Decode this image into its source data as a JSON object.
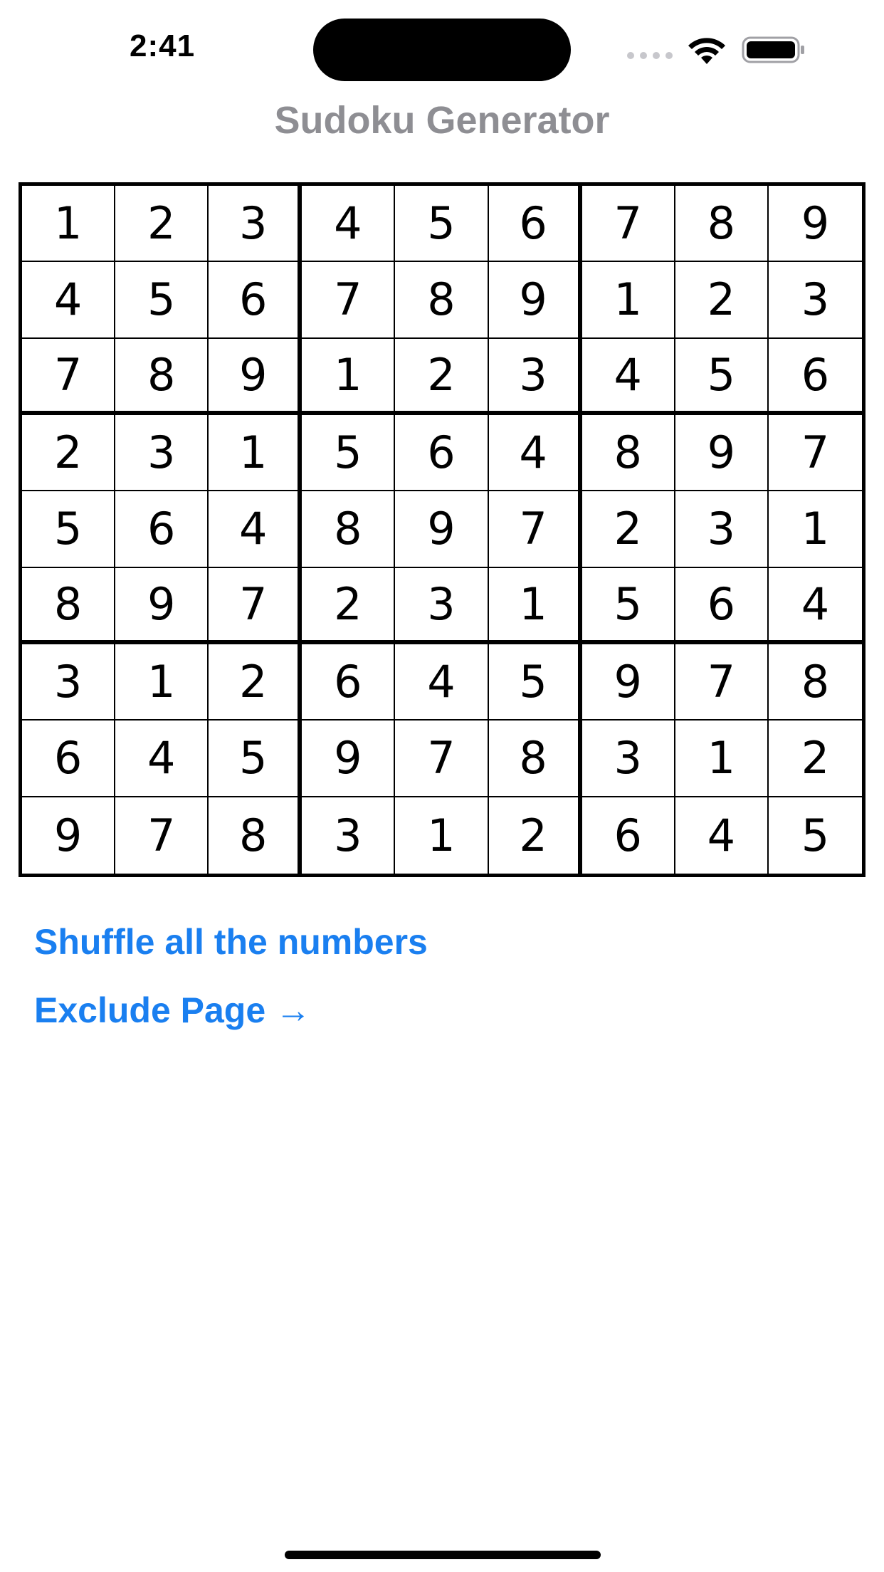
{
  "status_bar": {
    "time": "2:41"
  },
  "title": "Sudoku Generator",
  "grid": [
    [
      1,
      2,
      3,
      4,
      5,
      6,
      7,
      8,
      9
    ],
    [
      4,
      5,
      6,
      7,
      8,
      9,
      1,
      2,
      3
    ],
    [
      7,
      8,
      9,
      1,
      2,
      3,
      4,
      5,
      6
    ],
    [
      2,
      3,
      1,
      5,
      6,
      4,
      8,
      9,
      7
    ],
    [
      5,
      6,
      4,
      8,
      9,
      7,
      2,
      3,
      1
    ],
    [
      8,
      9,
      7,
      2,
      3,
      1,
      5,
      6,
      4
    ],
    [
      3,
      1,
      2,
      6,
      4,
      5,
      9,
      7,
      8
    ],
    [
      6,
      4,
      5,
      9,
      7,
      8,
      3,
      1,
      2
    ],
    [
      9,
      7,
      8,
      3,
      1,
      2,
      6,
      4,
      5
    ]
  ],
  "actions": {
    "shuffle_label": "Shuffle all the numbers",
    "exclude_label": "Exclude Page →"
  },
  "colors": {
    "accent": "#1a7ff0",
    "title": "#8e8e93"
  },
  "icons": {
    "signal": "cellular-signal-icon",
    "wifi": "wifi-icon",
    "battery": "battery-icon"
  }
}
